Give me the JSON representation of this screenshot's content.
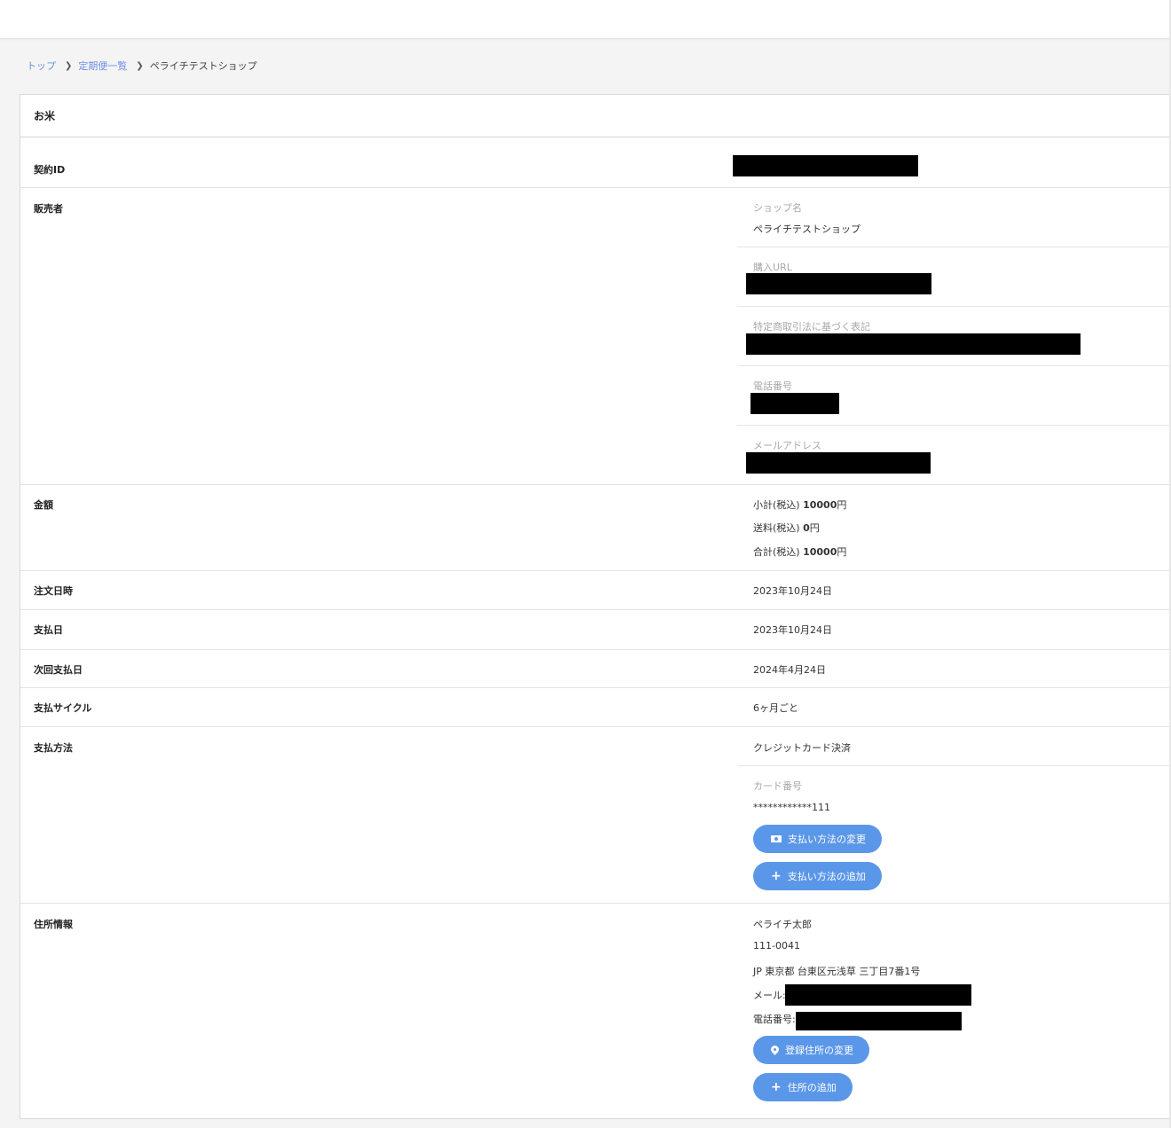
{
  "breadcrumb": {
    "items": [
      "トップ",
      "定期便一覧"
    ],
    "current": "ペライチテストショップ"
  },
  "card": {
    "title": "お米",
    "contract_id": {
      "label": "契約ID"
    },
    "seller": {
      "label": "販売者",
      "shop_name_label": "ショップ名",
      "shop_name": "ペライチテストショップ",
      "purchase_url_label": "購入URL",
      "legal_label": "特定商取引法に基づく表記",
      "phone_label": "電話番号",
      "email_label": "メールアドレス"
    },
    "amount": {
      "label": "金額",
      "subtotal_label": "小計(税込)",
      "subtotal": "10000",
      "shipping_label": "送料(税込)",
      "shipping": "0",
      "total_label": "合計(税込)",
      "total": "10000",
      "currency": "円"
    },
    "order_date": {
      "label": "注文日時",
      "value": "2023年10月24日"
    },
    "payment_date": {
      "label": "支払日",
      "value": "2023年10月24日"
    },
    "next_payment_date": {
      "label": "次回支払日",
      "value": "2024年4月24日"
    },
    "payment_cycle": {
      "label": "支払サイクル",
      "value": "6ヶ月ごと"
    },
    "payment_method": {
      "label": "支払方法",
      "value": "クレジットカード決済",
      "card_number_label": "カード番号",
      "card_number": "************111",
      "change_button": "支払い方法の変更",
      "add_button": "支払い方法の追加"
    },
    "address": {
      "label": "住所情報",
      "name": "ペライチ太郎",
      "postal": "111-0041",
      "address_line": "JP 東京都 台東区元浅草 三丁目7番1号",
      "email_prefix": "メール:",
      "phone_prefix": "電話番号:",
      "change_button": "登録住所の変更",
      "add_button": "住所の追加"
    }
  },
  "colors": {
    "accent": "#5b97e8",
    "link": "#6c8fe6",
    "redaction": "#000000"
  },
  "icons": {
    "card": "credit-card-icon",
    "plus": "plus-icon",
    "pin": "map-pin-icon",
    "chevron": "chevron-right-icon"
  }
}
